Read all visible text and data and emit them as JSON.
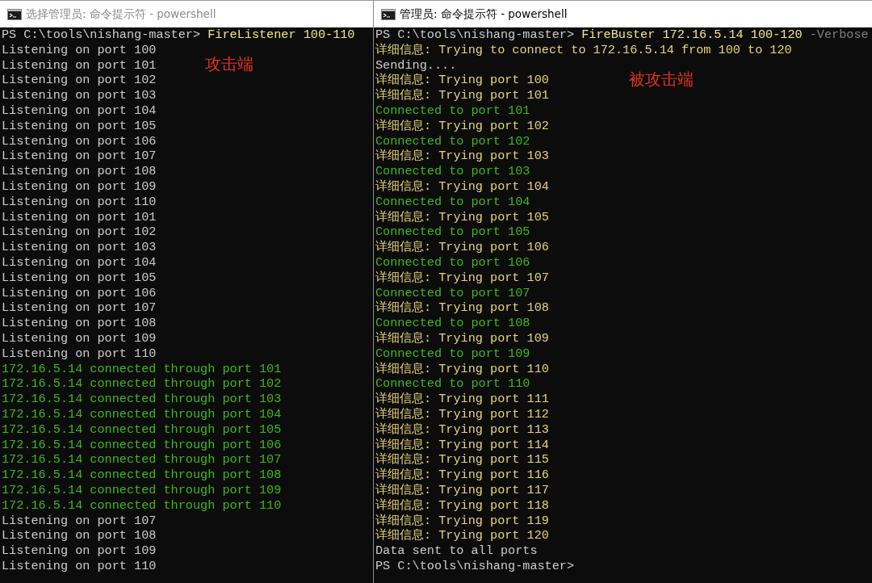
{
  "windows": [
    {
      "title": "选择管理员: 命令提示符 - powershell",
      "active": false,
      "annotation": "攻击端",
      "lines": [
        {
          "segments": [
            {
              "text": "PS C:\\tools\\nishang-master> ",
              "kind": "output"
            },
            {
              "text": "FireListener 100-110",
              "kind": "command"
            }
          ]
        },
        {
          "kind": "output",
          "text": "Listening on port 100"
        },
        {
          "kind": "output",
          "text": "Listening on port 101"
        },
        {
          "kind": "output",
          "text": "Listening on port 102"
        },
        {
          "kind": "output",
          "text": "Listening on port 103"
        },
        {
          "kind": "output",
          "text": "Listening on port 104"
        },
        {
          "kind": "output",
          "text": "Listening on port 105"
        },
        {
          "kind": "output",
          "text": "Listening on port 106"
        },
        {
          "kind": "output",
          "text": "Listening on port 107"
        },
        {
          "kind": "output",
          "text": "Listening on port 108"
        },
        {
          "kind": "output",
          "text": "Listening on port 109"
        },
        {
          "kind": "output",
          "text": "Listening on port 110"
        },
        {
          "kind": "output",
          "text": "Listening on port 101"
        },
        {
          "kind": "output",
          "text": "Listening on port 102"
        },
        {
          "kind": "output",
          "text": "Listening on port 103"
        },
        {
          "kind": "output",
          "text": "Listening on port 104"
        },
        {
          "kind": "output",
          "text": "Listening on port 105"
        },
        {
          "kind": "output",
          "text": "Listening on port 106"
        },
        {
          "kind": "output",
          "text": "Listening on port 107"
        },
        {
          "kind": "output",
          "text": "Listening on port 108"
        },
        {
          "kind": "output",
          "text": "Listening on port 109"
        },
        {
          "kind": "output",
          "text": "Listening on port 110"
        },
        {
          "kind": "success",
          "text": "172.16.5.14 connected through port 101"
        },
        {
          "kind": "success",
          "text": "172.16.5.14 connected through port 102"
        },
        {
          "kind": "success",
          "text": "172.16.5.14 connected through port 103"
        },
        {
          "kind": "success",
          "text": "172.16.5.14 connected through port 104"
        },
        {
          "kind": "success",
          "text": "172.16.5.14 connected through port 105"
        },
        {
          "kind": "success",
          "text": "172.16.5.14 connected through port 106"
        },
        {
          "kind": "success",
          "text": "172.16.5.14 connected through port 107"
        },
        {
          "kind": "success",
          "text": "172.16.5.14 connected through port 108"
        },
        {
          "kind": "success",
          "text": "172.16.5.14 connected through port 109"
        },
        {
          "kind": "success",
          "text": "172.16.5.14 connected through port 110"
        },
        {
          "kind": "output",
          "text": "Listening on port 107"
        },
        {
          "kind": "output",
          "text": "Listening on port 108"
        },
        {
          "kind": "output",
          "text": "Listening on port 109"
        },
        {
          "kind": "output",
          "text": "Listening on port 110"
        }
      ]
    },
    {
      "title": "管理员: 命令提示符 - powershell",
      "active": true,
      "annotation": "被攻击端",
      "lines": [
        {
          "segments": [
            {
              "text": "PS C:\\tools\\nishang-master> ",
              "kind": "output"
            },
            {
              "text": "FireBuster 172.16.5.14 100-120",
              "kind": "command"
            },
            {
              "text": " -Verbose",
              "kind": "parameter"
            }
          ]
        },
        {
          "kind": "verbose",
          "text": "详细信息: Trying to connect to 172.16.5.14 from 100 to 120"
        },
        {
          "kind": "output",
          "text": "Sending...."
        },
        {
          "kind": "verbose",
          "text": "详细信息: Trying port 100"
        },
        {
          "kind": "verbose",
          "text": "详细信息: Trying port 101"
        },
        {
          "kind": "success",
          "text": "Connected to port 101"
        },
        {
          "kind": "verbose",
          "text": "详细信息: Trying port 102"
        },
        {
          "kind": "success",
          "text": "Connected to port 102"
        },
        {
          "kind": "verbose",
          "text": "详细信息: Trying port 103"
        },
        {
          "kind": "success",
          "text": "Connected to port 103"
        },
        {
          "kind": "verbose",
          "text": "详细信息: Trying port 104"
        },
        {
          "kind": "success",
          "text": "Connected to port 104"
        },
        {
          "kind": "verbose",
          "text": "详细信息: Trying port 105"
        },
        {
          "kind": "success",
          "text": "Connected to port 105"
        },
        {
          "kind": "verbose",
          "text": "详细信息: Trying port 106"
        },
        {
          "kind": "success",
          "text": "Connected to port 106"
        },
        {
          "kind": "verbose",
          "text": "详细信息: Trying port 107"
        },
        {
          "kind": "success",
          "text": "Connected to port 107"
        },
        {
          "kind": "verbose",
          "text": "详细信息: Trying port 108"
        },
        {
          "kind": "success",
          "text": "Connected to port 108"
        },
        {
          "kind": "verbose",
          "text": "详细信息: Trying port 109"
        },
        {
          "kind": "success",
          "text": "Connected to port 109"
        },
        {
          "kind": "verbose",
          "text": "详细信息: Trying port 110"
        },
        {
          "kind": "success",
          "text": "Connected to port 110"
        },
        {
          "kind": "verbose",
          "text": "详细信息: Trying port 111"
        },
        {
          "kind": "verbose",
          "text": "详细信息: Trying port 112"
        },
        {
          "kind": "verbose",
          "text": "详细信息: Trying port 113"
        },
        {
          "kind": "verbose",
          "text": "详细信息: Trying port 114"
        },
        {
          "kind": "verbose",
          "text": "详细信息: Trying port 115"
        },
        {
          "kind": "verbose",
          "text": "详细信息: Trying port 116"
        },
        {
          "kind": "verbose",
          "text": "详细信息: Trying port 117"
        },
        {
          "kind": "verbose",
          "text": "详细信息: Trying port 118"
        },
        {
          "kind": "verbose",
          "text": "详细信息: Trying port 119"
        },
        {
          "kind": "verbose",
          "text": "详细信息: Trying port 120"
        },
        {
          "kind": "output",
          "text": "Data sent to all ports"
        },
        {
          "segments": [
            {
              "text": "PS C:\\tools\\nishang-master>",
              "kind": "output"
            }
          ]
        }
      ]
    }
  ]
}
